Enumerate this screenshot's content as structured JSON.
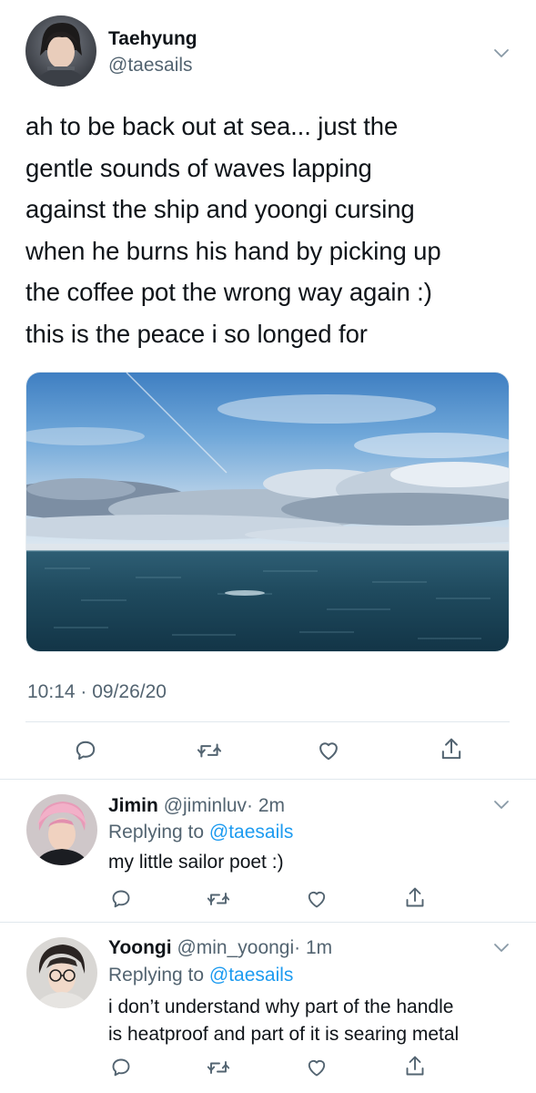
{
  "main_tweet": {
    "author_name": "Taehyung",
    "author_handle": "@taesails",
    "text_lines": [
      "ah to be back out at sea... just the",
      "gentle sounds of waves lapping",
      "against the ship and yoongi cursing",
      "when he burns his hand by picking up",
      "the coffee pot the wrong way again :)",
      "this is the peace i so longed for"
    ],
    "timestamp": "10:14 · 09/26/20"
  },
  "replies": [
    {
      "name": "Jimin",
      "handle": "@jiminluv",
      "time": "· 2m",
      "replying_prefix": "Replying to ",
      "replying_to": "@taesails",
      "text_lines": [
        "my little sailor poet :)"
      ]
    },
    {
      "name": "Yoongi",
      "handle": "@min_yoongi",
      "time": "· 1m",
      "replying_prefix": "Replying to ",
      "replying_to": "@taesails",
      "text_lines": [
        "i don’t understand why part of the handle",
        "is heatproof and part of it is searing metal"
      ]
    }
  ],
  "icons": {
    "reply": "reply-bubble-icon",
    "retweet": "retweet-icon",
    "like": "heart-icon",
    "share": "share-icon",
    "menu": "chevron-down-icon"
  },
  "colors": {
    "text": "#0f1419",
    "secondary": "#536471",
    "link": "#1d9bf0",
    "divider": "#e1e8ed"
  }
}
